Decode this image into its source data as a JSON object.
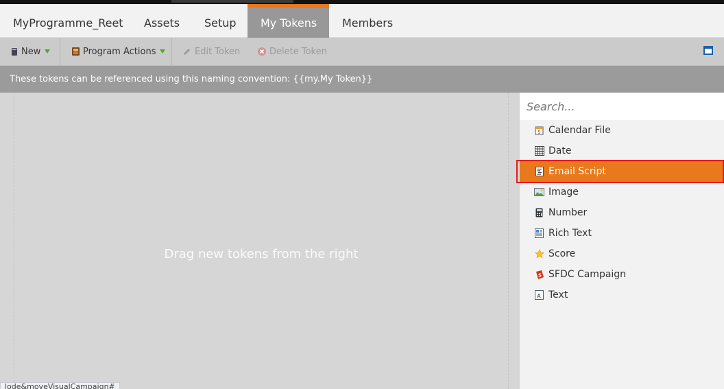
{
  "tabs": [
    {
      "label": "MyProgramme_Reet"
    },
    {
      "label": "Assets"
    },
    {
      "label": "Setup"
    },
    {
      "label": "My Tokens"
    },
    {
      "label": "Members"
    }
  ],
  "toolbar": {
    "new_label": "New",
    "program_actions_label": "Program Actions",
    "edit_token_label": "Edit Token",
    "delete_token_label": "Delete Token"
  },
  "info": {
    "text": "These tokens can be referenced using this naming convention: {{my.My Token}}"
  },
  "canvas": {
    "hint": "Drag new tokens from the right"
  },
  "status": {
    "url": "lode&moveVisualCampaign#"
  },
  "search": {
    "placeholder": "Search..."
  },
  "tokens": [
    {
      "label": "Calendar File",
      "icon": "calendar-file-icon"
    },
    {
      "label": "Date",
      "icon": "date-grid-icon"
    },
    {
      "label": "Email Script",
      "icon": "email-script-icon"
    },
    {
      "label": "Image",
      "icon": "image-icon"
    },
    {
      "label": "Number",
      "icon": "calculator-icon"
    },
    {
      "label": "Rich Text",
      "icon": "rich-text-icon"
    },
    {
      "label": "Score",
      "icon": "star-icon"
    },
    {
      "label": "SFDC Campaign",
      "icon": "sfdc-campaign-icon"
    },
    {
      "label": "Text",
      "icon": "text-icon"
    }
  ],
  "colors": {
    "accent": "#e8791c",
    "highlight_border": "#e31b1b",
    "active_tab_bg": "#989898",
    "info_bar_bg": "#9b9b9b"
  }
}
